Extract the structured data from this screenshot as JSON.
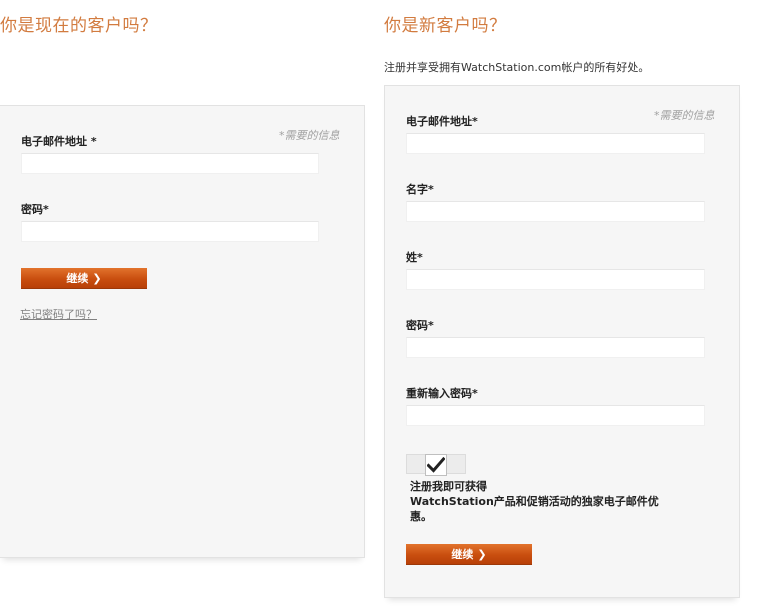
{
  "returning": {
    "heading": "你是现在的客户吗？",
    "required_note": "*需要的信息",
    "email_label": "电子邮件地址 *",
    "email_value": "",
    "password_label": "密码*",
    "password_value": "",
    "continue_label": "继续",
    "forgot_link": "忘记密码了吗？"
  },
  "new_customer": {
    "heading": "你是新客户吗？",
    "subtitle": "注册并享受拥有WatchStation.com帐户的所有好处。",
    "required_note": "*需要的信息",
    "email_label": "电子邮件地址*",
    "email_value": "",
    "first_name_label": "名字*",
    "first_name_value": "",
    "last_name_label": "姓*",
    "last_name_value": "",
    "password_label": "密码*",
    "password_value": "",
    "confirm_password_label": "重新输入密码*",
    "confirm_password_value": "",
    "newsletter_checked": true,
    "newsletter_line1": "注册我即可获得",
    "newsletter_line2": "WatchStation产品和促销活动的独家电子邮件优惠。",
    "continue_label": "继续"
  },
  "colors": {
    "heading": "#d27b3f",
    "button": "#c94e0f",
    "panel": "#f6f6f6"
  },
  "icons": {
    "button_arrow": "chevron-right-icon",
    "checkbox": "checkmark-icon"
  }
}
